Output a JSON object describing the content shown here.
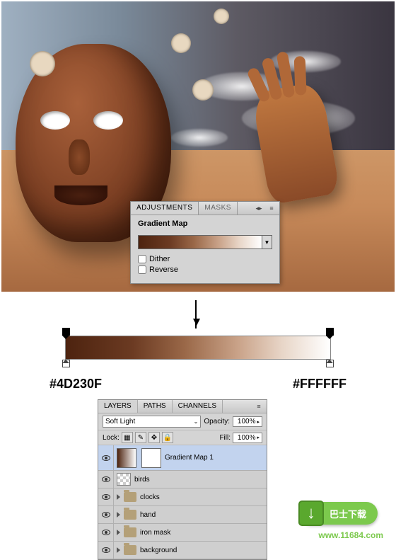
{
  "artwork": {
    "description": "Surreal desert composite with cracked face mask, hand, clocks and birds"
  },
  "adjustments_panel": {
    "tabs": {
      "active": "ADJUSTMENTS",
      "inactive": "MASKS"
    },
    "title": "Gradient Map",
    "dither_label": "Dither",
    "reverse_label": "Reverse",
    "dither_checked": false,
    "reverse_checked": false
  },
  "gradient_editor": {
    "left_hex": "#4D230F",
    "right_hex": "#FFFFFF"
  },
  "layers_panel": {
    "tabs": [
      "LAYERS",
      "PATHS",
      "CHANNELS"
    ],
    "active_tab": "LAYERS",
    "blend_mode": "Soft Light",
    "opacity_label": "Opacity:",
    "opacity_value": "100%",
    "fill_label": "Fill:",
    "fill_value": "100%",
    "lock_label": "Lock:",
    "layers": [
      {
        "name": "Gradient Map 1",
        "type": "adjustment",
        "selected": true
      },
      {
        "name": "birds",
        "type": "layer"
      },
      {
        "name": "clocks",
        "type": "group"
      },
      {
        "name": "hand",
        "type": "group"
      },
      {
        "name": "iron mask",
        "type": "group"
      },
      {
        "name": "background",
        "type": "group"
      }
    ]
  },
  "site": {
    "badge": "巴士下载",
    "url": "www.11684.com"
  },
  "chart_data": {
    "type": "gradient",
    "stops": [
      {
        "position": 0,
        "color": "#4D230F"
      },
      {
        "position": 100,
        "color": "#FFFFFF"
      }
    ]
  }
}
